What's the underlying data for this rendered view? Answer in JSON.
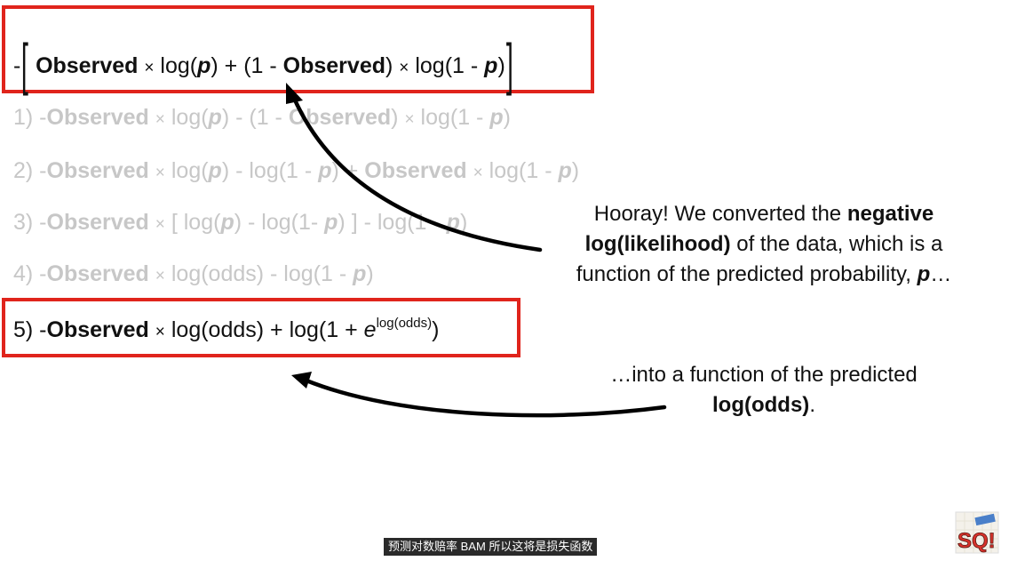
{
  "equations": {
    "top": {
      "minus": "-",
      "observed1": "Observed",
      "times1": "×",
      "log_open": "log(",
      "p1": "p",
      "close_plus": ") + (1 - ",
      "observed2": "Observed",
      "close1": ")",
      "times2": "×",
      "log1m": "log(1 - ",
      "p2": "p",
      "close2": ")"
    },
    "step1": {
      "num": "1) -",
      "observed": "Observed",
      "times": "×",
      "log_open": "log(",
      "p1": "p",
      "mid": ") - (1 - ",
      "observed2": "Observed",
      "close": ")",
      "times2": "×",
      "log1m": "log(1 - ",
      "p2": "p",
      "end": ")"
    },
    "step2": {
      "num": "2) -",
      "observed": "Observed",
      "times": "×",
      "log_open": "log(",
      "p1": "p",
      "mid": ") - log(1 - ",
      "p2": "p",
      "mid2": ") + ",
      "observed2": "Observed",
      "times2": "×",
      "log1m": "log(1 - ",
      "p3": "p",
      "end": ")"
    },
    "step3": {
      "num": "3) -",
      "observed": "Observed",
      "times": "×",
      "bracket_open": "[ log(",
      "p1": "p",
      "mid": ") - log(1- ",
      "p2": "p",
      "mid2": ") ] - log(1 - ",
      "p3": "p",
      "end": ")"
    },
    "step4": {
      "num": "4) -",
      "observed": "Observed",
      "times": "×",
      "logodds": "log(odds) - log(1 - ",
      "p1": "p",
      "end": ")"
    },
    "step5": {
      "num": "5) -",
      "observed": "Observed",
      "times": "×",
      "logodds": "log(odds) + log(1 + ",
      "e": "e",
      "exp": "log(odds)",
      "end": ")"
    }
  },
  "note1": {
    "line1_pre": "Hooray! We converted the ",
    "line1_bold": "negative",
    "line2_bold": "log(likelihood)",
    "line2_post": " of the data, which is a",
    "line3_pre": "function of the predicted probability, ",
    "line3_bold": "p",
    "line3_post": "…"
  },
  "note2": {
    "line1": "…into a function of the predicted",
    "line2_bold": "log(odds)",
    "line2_post": "."
  },
  "subtitle": "预测对数赔率 BAM 所以这将是损失函数",
  "logo": {
    "text": "SQ!",
    "color": "#d8322b"
  },
  "colors": {
    "highlight_box": "#e0241c",
    "faded_text": "#c7c7c7",
    "arrow": "#000000"
  }
}
